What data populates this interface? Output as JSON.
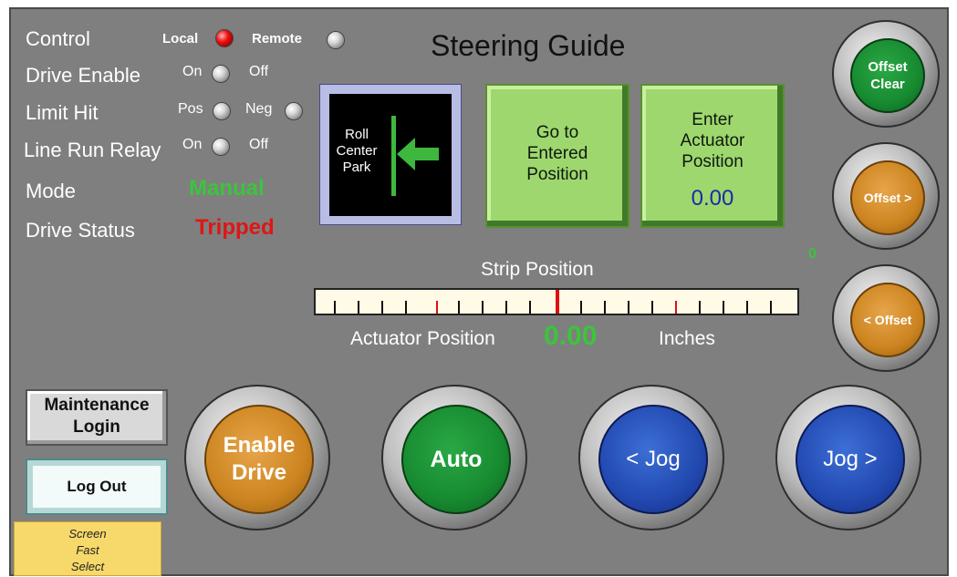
{
  "status_panel": {
    "control": {
      "label": "Control",
      "local": "Local",
      "remote": "Remote",
      "local_lamp": "red",
      "remote_lamp": "off"
    },
    "drive_enable": {
      "label": "Drive Enable",
      "on": "On",
      "off": "Off",
      "lamp": "off"
    },
    "limit_hit": {
      "label": "Limit Hit",
      "pos": "Pos",
      "neg": "Neg",
      "pos_lamp": "off",
      "neg_lamp": "off"
    },
    "line_run_relay": {
      "label": "Line Run Relay",
      "on": "On",
      "off": "Off",
      "lamp": "off"
    },
    "mode": {
      "label": "Mode",
      "value": "Manual",
      "color": "#3cc43c"
    },
    "drive_status": {
      "label": "Drive Status",
      "value": "Tripped",
      "color": "#e01515"
    }
  },
  "title": "Steering Guide",
  "roll_center": {
    "label_lines": [
      "Roll",
      "Center",
      "Park"
    ],
    "icon": "left-arrow-icon"
  },
  "buttons": {
    "go_to": {
      "lines": [
        "Go to",
        "Entered",
        "Position"
      ]
    },
    "enter_actuator": {
      "lines": [
        "Enter",
        "Actuator",
        "Position"
      ],
      "value": "0.00"
    },
    "offset_clear": {
      "lines": [
        "Offset",
        "Clear"
      ]
    },
    "offset_right": "Offset >",
    "offset_left": "< Offset",
    "offset_value": "0",
    "enable_drive": {
      "lines": [
        "Enable",
        "Drive"
      ]
    },
    "auto": "Auto",
    "jog_left": "< Jog",
    "jog_right": "Jog >"
  },
  "strip": {
    "label": "Strip Position",
    "actuator_label": "Actuator Position",
    "actuator_value": "0.00",
    "units": "Inches"
  },
  "left_nav": {
    "maintenance": {
      "lines": [
        "Maintenance",
        "Login"
      ]
    },
    "logout": "Log Out",
    "fast_select": {
      "lines": [
        "Screen",
        "Fast",
        "Select"
      ]
    }
  },
  "colors": {
    "panel": "#7f7f7f",
    "accent_green": "#3cc43c",
    "alarm_red": "#e01515",
    "value_blue": "#1a2ba8"
  }
}
